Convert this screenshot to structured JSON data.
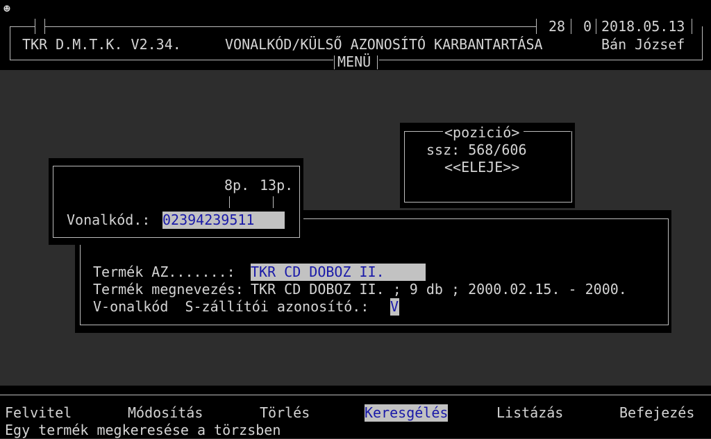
{
  "app_icon": "smiley-icon",
  "header": {
    "counter_a": "28",
    "counter_b": "0",
    "date": "2018.05.13",
    "app_title": "TKR D.M.T.K. V2.34.",
    "screen_title": "VONALKÓD/KÜLSŐ AZONOSÍTÓ KARBANTARTÁSA",
    "user": "Bán József",
    "menu_label": "MENÜ"
  },
  "position_panel": {
    "title": "<pozició>",
    "ssz": "ssz: 568/606",
    "status": "<<ELEJE>>"
  },
  "barcode_panel": {
    "marker1": "8p.",
    "marker2": "13p.",
    "label": "Vonalkód.:",
    "value": "02394239511"
  },
  "detail_panel": {
    "az_label": "Termék AZ.......:",
    "az_value": "TKR CD DOBOZ II.",
    "name_label": "Termék megnevezés:",
    "name_value": "TKR CD DOBOZ II. ; 9 db ; 2000.02.15. - 2000.",
    "type_label": "V-onalkód  S-zállítói azonosító.:",
    "type_value": "V"
  },
  "menu": {
    "items": [
      "Felvitel",
      "Módosítás",
      "Törlés",
      "Keresgélés",
      "Listázás",
      "Befejezés"
    ],
    "active_index": 3,
    "hint": "Egy termék megkeresése a törzsben"
  }
}
